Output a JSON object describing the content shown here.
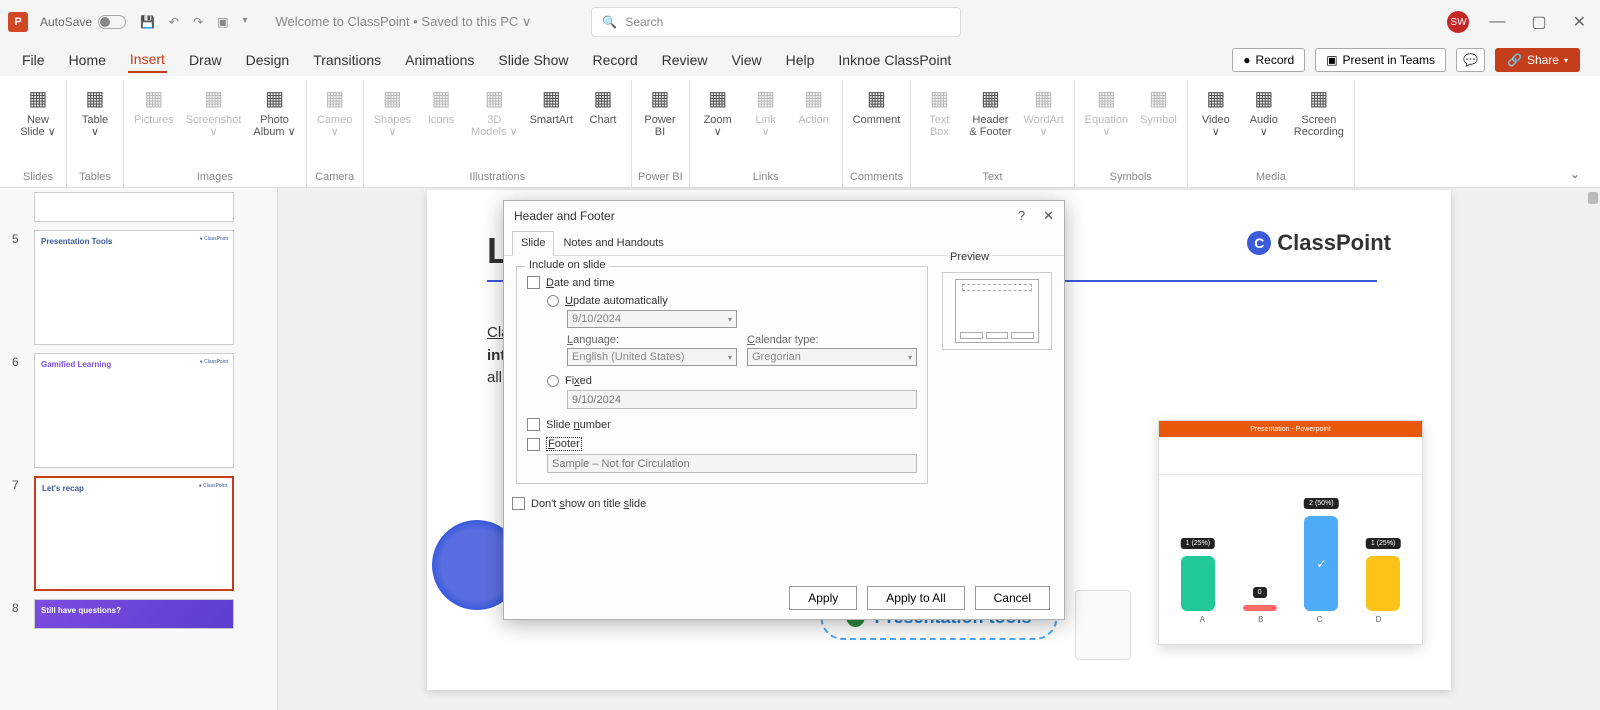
{
  "titlebar": {
    "app_letter": "P",
    "autosave": "AutoSave",
    "doc_title": "Welcome to ClassPoint • Saved to this PC ∨",
    "search_placeholder": "Search",
    "avatar": "SW"
  },
  "tabs": {
    "items": [
      "File",
      "Home",
      "Insert",
      "Draw",
      "Design",
      "Transitions",
      "Animations",
      "Slide Show",
      "Record",
      "Review",
      "View",
      "Help",
      "Inknoe ClassPoint"
    ],
    "active": "Insert",
    "record": "Record",
    "present": "Present in Teams",
    "share": "Share"
  },
  "ribbon": {
    "groups": [
      {
        "title": "Slides",
        "items": [
          {
            "label": "New\nSlide ∨"
          }
        ]
      },
      {
        "title": "Tables",
        "items": [
          {
            "label": "Table\n∨"
          }
        ]
      },
      {
        "title": "Images",
        "items": [
          {
            "label": "Pictures",
            "dis": true
          },
          {
            "label": "Screenshot\n∨",
            "dis": true
          },
          {
            "label": "Photo\nAlbum ∨"
          }
        ]
      },
      {
        "title": "Camera",
        "items": [
          {
            "label": "Cameo\n∨",
            "dis": true
          }
        ]
      },
      {
        "title": "Illustrations",
        "items": [
          {
            "label": "Shapes\n∨",
            "dis": true
          },
          {
            "label": "Icons",
            "dis": true
          },
          {
            "label": "3D\nModels ∨",
            "dis": true
          },
          {
            "label": "SmartArt"
          },
          {
            "label": "Chart"
          }
        ]
      },
      {
        "title": "Power BI",
        "items": [
          {
            "label": "Power\nBI"
          }
        ]
      },
      {
        "title": "Links",
        "items": [
          {
            "label": "Zoom\n∨"
          },
          {
            "label": "Link\n∨",
            "dis": true
          },
          {
            "label": "Action",
            "dis": true
          }
        ]
      },
      {
        "title": "Comments",
        "items": [
          {
            "label": "Comment"
          }
        ]
      },
      {
        "title": "Text",
        "items": [
          {
            "label": "Text\nBox",
            "dis": true
          },
          {
            "label": "Header\n& Footer"
          },
          {
            "label": "WordArt\n∨",
            "dis": true
          }
        ]
      },
      {
        "title": "Symbols",
        "items": [
          {
            "label": "Equation\n∨",
            "dis": true
          },
          {
            "label": "Symbol",
            "dis": true
          }
        ]
      },
      {
        "title": "Media",
        "items": [
          {
            "label": "Video\n∨"
          },
          {
            "label": "Audio\n∨"
          },
          {
            "label": "Screen\nRecording"
          }
        ]
      }
    ]
  },
  "thumbs": [
    {
      "n": "",
      "title": "",
      "partial": true
    },
    {
      "n": "5",
      "title": "Presentation Tools"
    },
    {
      "n": "6",
      "title": "Gamified Learning",
      "purple": true
    },
    {
      "n": "7",
      "title": "Let's recap",
      "selected": true
    },
    {
      "n": "8",
      "title": "Still have questions?",
      "purple": true,
      "partial_bottom": true
    }
  ],
  "slide": {
    "title_prefix": "Le",
    "brand": "ClassPoint",
    "body1": "Clas",
    "body2": "inte",
    "body3": "all s",
    "pill": "Presentation tools",
    "mock_title": "Presentation - Powerpoint"
  },
  "chart_data": {
    "type": "bar",
    "categories": [
      "A",
      "B",
      "C",
      "D"
    ],
    "series": [
      {
        "name": "",
        "values": [
          25,
          0,
          50,
          25
        ]
      }
    ],
    "labels": [
      "1 (25%)",
      "0",
      "2 (50%)",
      "1 (25%)"
    ],
    "xlabel": "",
    "ylabel": "",
    "ylim": [
      0,
      60
    ]
  },
  "dialog": {
    "title": "Header and Footer",
    "tabs": [
      "Slide",
      "Notes and Handouts"
    ],
    "legend": "Include on slide",
    "date_time": "Date and time",
    "update_auto": "Update automatically",
    "date_value": "9/10/2024",
    "language_label": "Language:",
    "language_value": "English (United States)",
    "calendar_label": "Calendar type:",
    "calendar_value": "Gregorian",
    "fixed": "Fixed",
    "fixed_value": "9/10/2024",
    "slide_number": "Slide number",
    "footer": "Footer",
    "footer_value": "Sample – Not for Circulation",
    "dont_show": "Don't show on title slide",
    "preview": "Preview",
    "apply": "Apply",
    "apply_all": "Apply to All",
    "cancel": "Cancel"
  }
}
